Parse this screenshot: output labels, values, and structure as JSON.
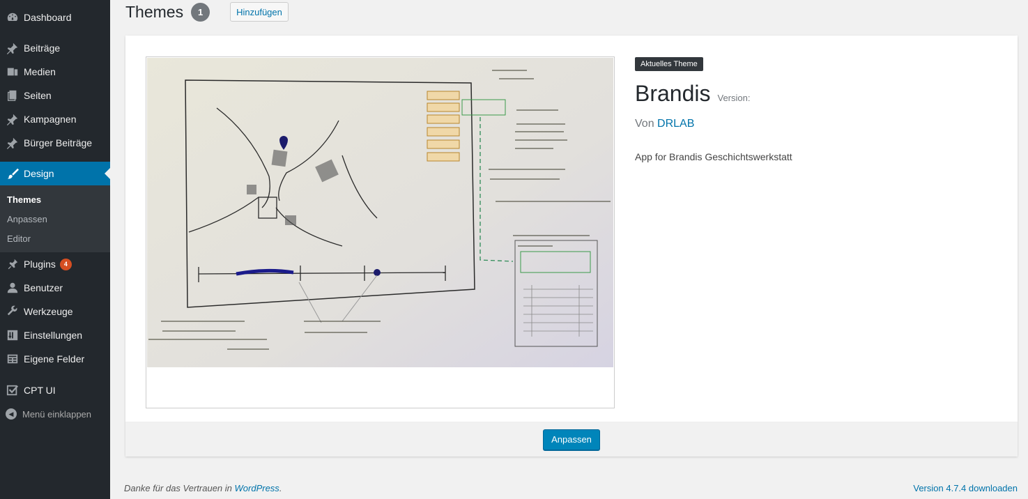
{
  "sidebar": {
    "items": [
      {
        "label": "Dashboard",
        "icon": "dashboard-icon"
      },
      {
        "label": "Beiträge",
        "icon": "pin-icon"
      },
      {
        "label": "Medien",
        "icon": "media-icon"
      },
      {
        "label": "Seiten",
        "icon": "pages-icon"
      },
      {
        "label": "Kampagnen",
        "icon": "pin-icon"
      },
      {
        "label": "Bürger Beiträge",
        "icon": "pin-icon"
      },
      {
        "label": "Design",
        "icon": "brush-icon"
      },
      {
        "label": "Plugins",
        "icon": "plugin-icon",
        "badge": "4"
      },
      {
        "label": "Benutzer",
        "icon": "user-icon"
      },
      {
        "label": "Werkzeuge",
        "icon": "wrench-icon"
      },
      {
        "label": "Einstellungen",
        "icon": "settings-icon"
      },
      {
        "label": "Eigene Felder",
        "icon": "table-icon"
      },
      {
        "label": "CPT UI",
        "icon": "checkbox-icon"
      }
    ],
    "submenu": [
      "Themes",
      "Anpassen",
      "Editor"
    ],
    "collapse_label": "Menü einklappen"
  },
  "header": {
    "title": "Themes",
    "count": "1",
    "add_label": "Hinzufügen"
  },
  "theme": {
    "current_label": "Aktuelles Theme",
    "name": "Brandis",
    "version_label": "Version:",
    "author_prefix": "Von",
    "author": "DRLAB",
    "description": "App for Brandis Geschichtswerkstatt",
    "customize_label": "Anpassen"
  },
  "footer": {
    "thanks_prefix": "Danke für das Vertrauen in",
    "thanks_link": "WordPress",
    "thanks_suffix": ".",
    "version_link": "Version 4.7.4 downloaden"
  },
  "colors": {
    "sidebar_bg": "#23282d",
    "accent": "#0073aa",
    "primary_button": "#0085ba",
    "badge": "#d54e21"
  }
}
